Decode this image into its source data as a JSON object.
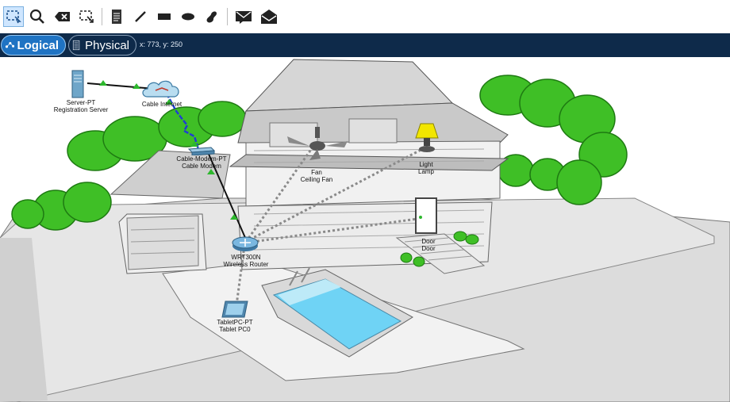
{
  "toolbar": {
    "tools": [
      {
        "name": "select-tool",
        "icon": "marquee-select-icon",
        "active": true
      },
      {
        "name": "inspect-tool",
        "icon": "magnifier-icon"
      },
      {
        "name": "delete-tool",
        "icon": "delete-icon"
      },
      {
        "name": "resize-shape-tool",
        "icon": "resize-icon"
      },
      {
        "name": "place-note-tool",
        "icon": "note-icon"
      },
      {
        "name": "draw-line-tool",
        "icon": "line-icon"
      },
      {
        "name": "draw-rectangle-tool",
        "icon": "rectangle-icon"
      },
      {
        "name": "draw-ellipse-tool",
        "icon": "ellipse-icon"
      },
      {
        "name": "draw-freeform-tool",
        "icon": "freeform-icon"
      },
      {
        "name": "add-simple-pdu-tool",
        "icon": "closed-envelope-icon"
      },
      {
        "name": "add-complex-pdu-tool",
        "icon": "open-envelope-icon"
      }
    ]
  },
  "modes": {
    "logical": "Logical",
    "physical": "Physical"
  },
  "cursor_coords": "x: 773, y: 250",
  "devices": {
    "server": {
      "type": "Server-PT",
      "name": "Registration Server"
    },
    "cloud": {
      "name": "Cable Internet"
    },
    "modem": {
      "type": "Cable-Modem-PT",
      "name": "Cable Modem"
    },
    "fan": {
      "type": "Fan",
      "name": "Ceiling Fan"
    },
    "lamp": {
      "type": "Light",
      "name": "Lamp"
    },
    "door": {
      "type": "Door",
      "name": "Door"
    },
    "router": {
      "type": "WRT300N",
      "name": "Wireless Router"
    },
    "tablet": {
      "type": "TabletPC-PT",
      "name": "Tablet PC0"
    }
  },
  "colors": {
    "modebar": "#0e2a4a",
    "active_mode": "#1f73c3",
    "link_up": "#2db82d",
    "cable": "#1f3fd1"
  }
}
